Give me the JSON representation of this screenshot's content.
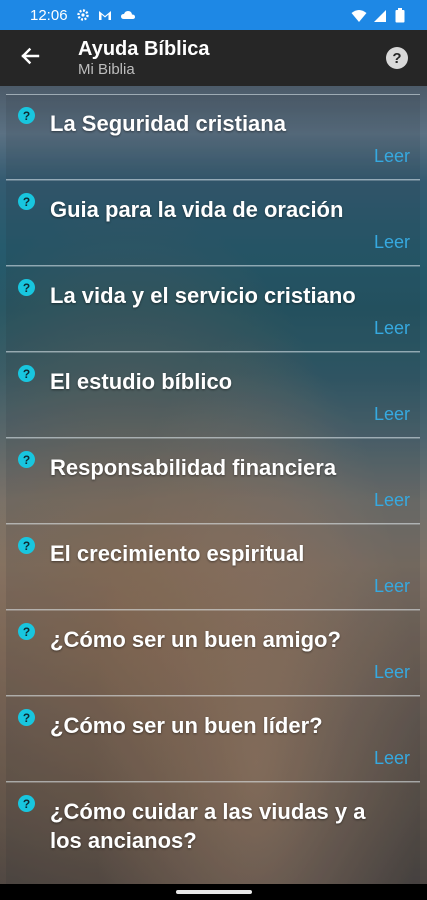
{
  "status_bar": {
    "time": "12:06"
  },
  "app_bar": {
    "title": "Ayuda Bíblica",
    "subtitle": "Mi Biblia"
  },
  "items": [
    {
      "title": "La Seguridad cristiana",
      "action": "Leer"
    },
    {
      "title": "Guia para la vida de oración",
      "action": "Leer"
    },
    {
      "title": "La vida y el servicio cristiano",
      "action": "Leer"
    },
    {
      "title": "El estudio bíblico",
      "action": "Leer"
    },
    {
      "title": "Responsabilidad financiera",
      "action": "Leer"
    },
    {
      "title": "El crecimiento espiritual",
      "action": "Leer"
    },
    {
      "title": "¿Cómo ser un buen amigo?",
      "action": "Leer"
    },
    {
      "title": "¿Cómo ser un buen líder?",
      "action": "Leer"
    },
    {
      "title": "¿Cómo cuidar a las viudas y a los ancianos?",
      "action": ""
    }
  ],
  "colors": {
    "status_bar": "#1e88e5",
    "app_bar": "#262626",
    "accent": "#36a9e0",
    "question_icon": "#18c6df"
  },
  "icons": {
    "back": "arrow-left-icon",
    "help": "help-circle-icon",
    "item": "question-circle-icon"
  }
}
